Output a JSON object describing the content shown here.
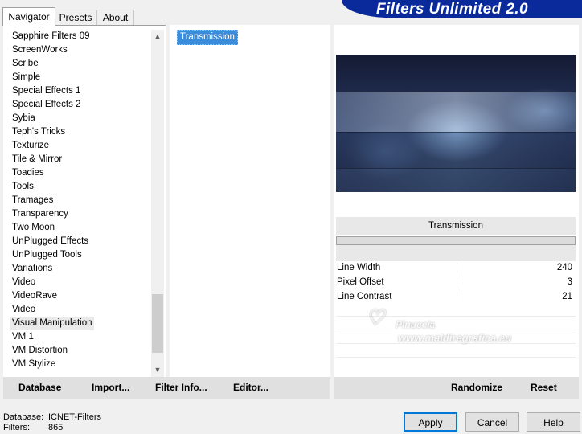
{
  "tabs": [
    "Navigator",
    "Presets",
    "About"
  ],
  "banner_title": "Filters Unlimited 2.0",
  "categories": [
    "Sapphire Filters 09",
    "ScreenWorks",
    "Scribe",
    "Simple",
    "Special Effects 1",
    "Special Effects 2",
    "Sybia",
    "Teph's Tricks",
    "Texturize",
    "Tile & Mirror",
    "Toadies",
    "Tools",
    "Tramages",
    "Transparency",
    "Two Moon",
    "UnPlugged Effects",
    "UnPlugged Tools",
    "Variations",
    "Video",
    "VideoRave",
    "Video",
    "Visual Manipulation",
    "VM 1",
    "VM Distortion",
    "VM Stylize"
  ],
  "selected_category": "Visual Manipulation",
  "filters": [
    "Transmission"
  ],
  "selected_filter": "Transmission",
  "param_title": "Transmission",
  "params": [
    {
      "name": "Line Width",
      "value": "240"
    },
    {
      "name": "Pixel Offset",
      "value": "3"
    },
    {
      "name": "Line Contrast",
      "value": "21"
    }
  ],
  "toolbar": {
    "database": "Database",
    "import": "Import...",
    "filter_info": "Filter Info...",
    "editor": "Editor...",
    "randomize": "Randomize",
    "reset": "Reset"
  },
  "status": {
    "database_label": "Database:",
    "database_value": "ICNET-Filters",
    "filters_label": "Filters:",
    "filters_value": "865"
  },
  "buttons": {
    "apply": "Apply",
    "cancel": "Cancel",
    "help": "Help"
  },
  "watermark": {
    "line1": "Pinuccia",
    "line2": "www.maldiregrafica.eu"
  },
  "colors": {
    "banner": "#0a2a9c",
    "selection": "#3c8cdc"
  }
}
